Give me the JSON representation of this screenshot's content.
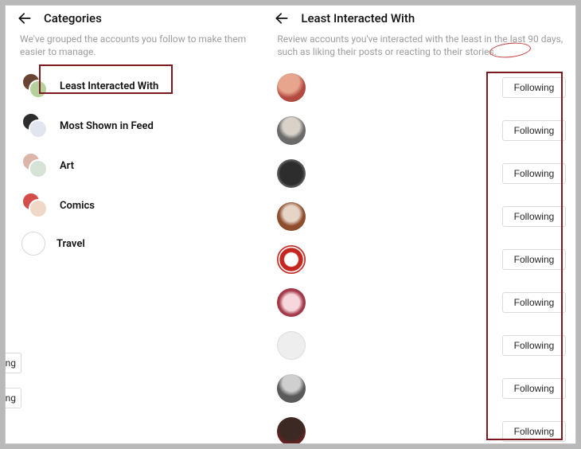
{
  "left": {
    "title": "Categories",
    "subtext": "We've grouped the accounts you follow to make them easier to manage.",
    "items": [
      {
        "label": "Least Interacted With"
      },
      {
        "label": "Most Shown in Feed"
      },
      {
        "label": "Art"
      },
      {
        "label": "Comics"
      },
      {
        "label": "Travel"
      }
    ]
  },
  "right": {
    "title": "Least Interacted With",
    "subtext": "Review accounts you've interacted with the least in the last 90 days, such as liking their posts or reacting to their stories.",
    "follow_label": "Following",
    "accounts": [
      {
        "avatar": "av1"
      },
      {
        "avatar": "av2"
      },
      {
        "avatar": "av3"
      },
      {
        "avatar": "av4"
      },
      {
        "avatar": "av5"
      },
      {
        "avatar": "av6"
      },
      {
        "avatar": "av7"
      },
      {
        "avatar": "av8"
      },
      {
        "avatar": "av9"
      }
    ]
  },
  "ghost": {
    "label": "ng"
  }
}
